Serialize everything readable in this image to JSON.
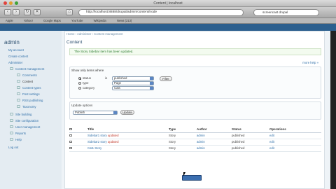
{
  "window": {
    "title": "Content | localhost"
  },
  "browser": {
    "url": "http://localhost:8888/drupal/admin/content/node",
    "search": "screencast drupal"
  },
  "bookmarks": [
    "Apple",
    "Yahoo!",
    "Google Maps",
    "YouTube",
    "Wikipedia",
    "News (213)"
  ],
  "site": {
    "name": "admin"
  },
  "sidebar": {
    "items": [
      "My account",
      "Create content",
      "Administer",
      "Content management",
      "Comments",
      "Content",
      "Content types",
      "Post settings",
      "RSS publishing",
      "Taxonomy",
      "Site building",
      "Site configuration",
      "User management",
      "Reports",
      "Help",
      "Log out"
    ]
  },
  "breadcrumb": "Home › Administer › Content management",
  "page_title": "Content",
  "status_message": "The Story Sidebar item has been updated.",
  "view_more": "more help »",
  "filters": {
    "legend": "Show only items where",
    "labels": [
      "status",
      "type",
      "category"
    ],
    "is": "is",
    "values": [
      "published",
      "Page",
      "Cats"
    ],
    "filter_button": "Filter"
  },
  "update": {
    "legend": "Update options",
    "select": "Publish",
    "button": "Update"
  },
  "table": {
    "headers": [
      "",
      "Title",
      "Type",
      "Author",
      "Status",
      "Operations"
    ],
    "rows": [
      {
        "title": "Sidebar1 story",
        "flag": "updated",
        "type": "Story",
        "author": "admin",
        "status": "published",
        "op": "edit"
      },
      {
        "title": "Sidebar2 story",
        "flag": "updated",
        "type": "Story",
        "author": "admin",
        "status": "published",
        "op": "edit"
      },
      {
        "title": "Cat1 Story",
        "flag": "",
        "type": "Story",
        "author": "admin",
        "status": "published",
        "op": "edit"
      }
    ]
  }
}
